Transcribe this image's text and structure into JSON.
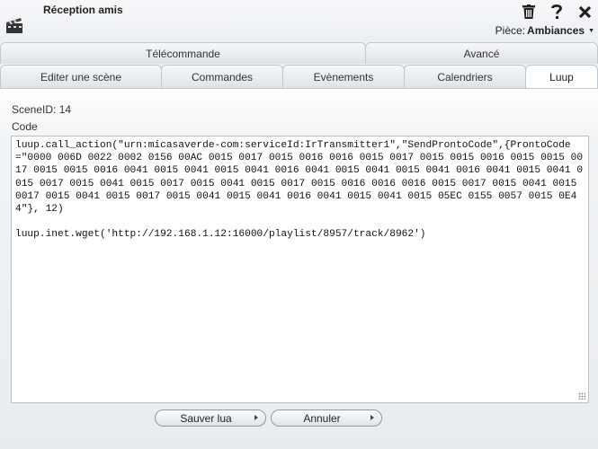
{
  "window": {
    "title": "Réception amis",
    "room_label": "Pièce:",
    "room_value": "Ambiances"
  },
  "tabs_row1": [
    {
      "label": "Télécommande"
    },
    {
      "label": "Avancé"
    }
  ],
  "tabs_row2": [
    {
      "label": "Editer une scène"
    },
    {
      "label": "Commandes"
    },
    {
      "label": "Evènements"
    },
    {
      "label": "Calendriers"
    },
    {
      "label": "Luup",
      "active": true
    }
  ],
  "scene": {
    "scene_id_text": "SceneID: 14",
    "code_label": "Code",
    "code": "luup.call_action(\"urn:micasaverde-com:serviceId:IrTransmitter1\",\"SendProntoCode\",{ProntoCode=\"0000 006D 0022 0002 0156 00AC 0015 0017 0015 0016 0016 0015 0017 0015 0015 0016 0015 0015 0017 0015 0015 0016 0041 0015 0041 0015 0041 0016 0041 0015 0041 0015 0041 0016 0041 0015 0041 0015 0017 0015 0041 0015 0017 0015 0041 0015 0017 0015 0016 0016 0016 0015 0017 0015 0041 0015 0017 0015 0041 0015 0017 0015 0041 0015 0041 0016 0041 0015 0041 0015 05EC 0155 0057 0015 0E44\"}, 12)\n\nluup.inet.wget('http://192.168.1.12:16000/playlist/8957/track/8962')"
  },
  "buttons": {
    "save_label": "Sauver lua",
    "cancel_label": "Annuler"
  },
  "colors": {
    "tab_border": "#c2c8ce",
    "active_tab": "#ffffff",
    "button_border": "#8d99a6"
  },
  "icons": {
    "app": "clapperboard-icon",
    "delete": "trash-icon",
    "help": "question-mark-icon",
    "close": "close-icon"
  }
}
